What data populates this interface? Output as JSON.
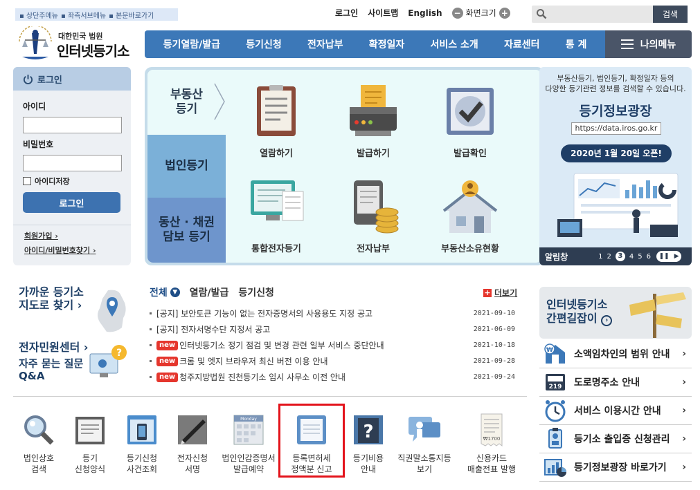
{
  "skip_links": [
    "상단주메뉴",
    "좌측서브메뉴",
    "본문바로가기"
  ],
  "top_links": {
    "login": "로그인",
    "sitemap": "사이트맵",
    "english": "English",
    "zoom_label": "화면크기"
  },
  "search": {
    "button": "검색",
    "placeholder": ""
  },
  "logo": {
    "line1": "대한민국 법원",
    "line2": "인터넷등기소"
  },
  "gnb": [
    "등기열람/발급",
    "등기신청",
    "전자납부",
    "확정일자",
    "서비스 소개",
    "자료센터",
    "통 계"
  ],
  "my_menu": "나의메뉴",
  "login_box": {
    "title": "로그인",
    "id_label": "아이디",
    "pw_label": "비밀번호",
    "save_id": "아이디저장",
    "button": "로그인",
    "signup": "회원가입",
    "find": "아이디/비밀번호찾기"
  },
  "service": {
    "tabs": [
      "부동산\n등기",
      "법인등기",
      "동산 · 채권\n담보 등기"
    ],
    "items": [
      "열람하기",
      "발급하기",
      "발급확인",
      "통합전자등기",
      "전자납부",
      "부동산소유현황"
    ]
  },
  "banner": {
    "line1": "부동산등기, 법인등기, 확정일자 등의",
    "line2": "다양한 등기관련 정보를 검색할 수 있습니다.",
    "title": "등기정보광장",
    "url": "https://data.iros.go.kr",
    "open": "2020년 1월 20일 오픈!",
    "bar_label": "알림창",
    "pages": [
      "1",
      "2",
      "3",
      "4",
      "5",
      "6"
    ],
    "active_page": "3"
  },
  "left_links": {
    "office_1": "가까운 등기소",
    "office_2": "지도로 찾기",
    "center": "전자민원센터",
    "faq_1": "자주 묻는 질문",
    "faq_2": "Q&A"
  },
  "news_tabs": {
    "all": "전체",
    "view": "열람/발급",
    "apply": "등기신청",
    "more": "더보기"
  },
  "news": [
    {
      "new": "",
      "title": "[공지] 보안토큰 기능이 없는 전자증명서의 사용용도 지정 공고",
      "date": "2021-09-10"
    },
    {
      "new": "",
      "title": "[공지] 전자서명수단 지정서 공고",
      "date": "2021-06-09"
    },
    {
      "new": "new",
      "title": "인터넷등기소 정기 점검 및 변경 관련 일부 서비스 중단안내",
      "date": "2021-10-18"
    },
    {
      "new": "new",
      "title": "크롬 및 엣지 브라우저 최신 버전 이용 안내",
      "date": "2021-09-28"
    },
    {
      "new": "new",
      "title": "청주지방법원 진천등기소 임시 사무소 이전 안내",
      "date": "2021-09-24"
    }
  ],
  "quick": [
    {
      "l1": "법인상호",
      "l2": "검색"
    },
    {
      "l1": "등기",
      "l2": "신청양식"
    },
    {
      "l1": "등기신청",
      "l2": "사건조회"
    },
    {
      "l1": "전자신청",
      "l2": "서명"
    },
    {
      "l1": "법인인감증명서",
      "l2": "발급예약"
    },
    {
      "l1": "등록면허세",
      "l2": "정액분 신고"
    },
    {
      "l1": "등기비용",
      "l2": "안내"
    },
    {
      "l1": "직권말소통지등",
      "l2": "보기"
    },
    {
      "l1": "신용카드",
      "l2": "매출전표 발행"
    }
  ],
  "quick_icon_text": {
    "calendar": "Monday",
    "receipt": "₩1700"
  },
  "guide": {
    "line1": "인터넷등기소",
    "line2": "간편길잡이"
  },
  "right_list": [
    "소액임차인의 범위 안내",
    "도로명주소 안내",
    "서비스 이용시간 안내",
    "등기소 출입증 신청관리",
    "등기정보광장 바로가기"
  ],
  "road_sign_number": "219"
}
